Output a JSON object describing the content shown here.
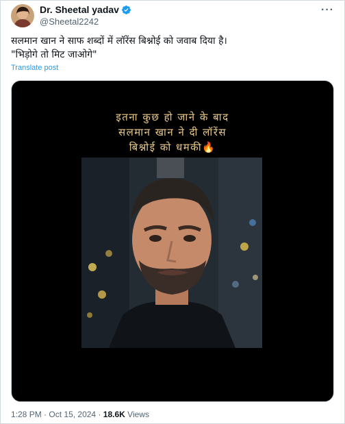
{
  "author": {
    "name": "Dr. Sheetal yadav",
    "handle": "@Sheetal2242"
  },
  "post": {
    "text_line1": "सलमान खान ने साफ शब्दों में लॉरेंस बिश्नोई को जवाब दिया है।",
    "text_line2": "\"भिड़ोगे तो मिट जाओगे\"",
    "translate_label": "Translate post"
  },
  "media": {
    "caption_line1": "इतना कुछ हो जाने के बाद",
    "caption_line2": "सलमान खान ने दी लॉरेंस",
    "caption_line3": "बिश्नोई को धमकी🔥"
  },
  "meta": {
    "time": "1:28 PM",
    "date": "Oct 15, 2024",
    "views_count": "18.6K",
    "views_label": "Views",
    "separator": "·"
  },
  "icons": {
    "verified": "verified-badge-icon",
    "more": "more-options-icon"
  },
  "colors": {
    "link": "#1d9bf0",
    "secondary_text": "#536471",
    "caption": "#e8c98a"
  }
}
